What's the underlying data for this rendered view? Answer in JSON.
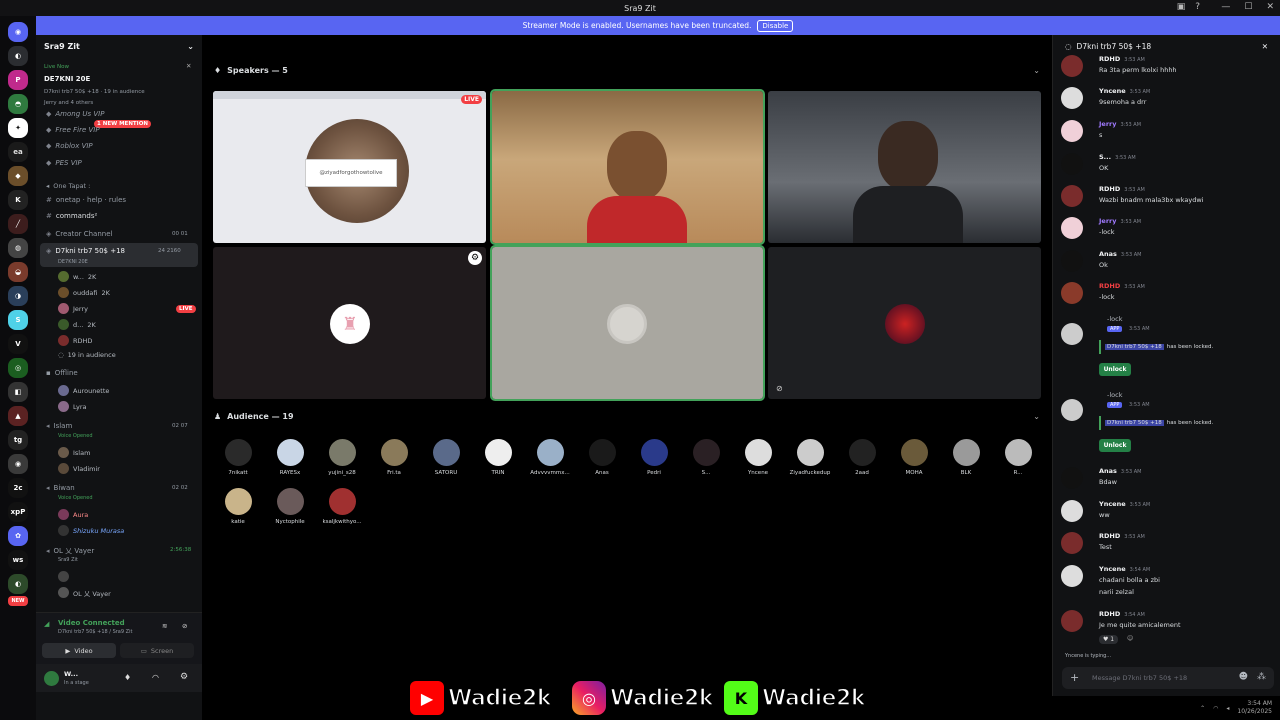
{
  "window": {
    "title": "Sra9 Zit"
  },
  "banner": {
    "text": "Streamer Mode is enabled. Usernames have been truncated.",
    "button": "Disable"
  },
  "rail": {
    "badges": [
      "82",
      "ea",
      "tg",
      "2c",
      "xpP",
      "ws",
      "NEW"
    ]
  },
  "sidebar": {
    "server_name": "Sra9 Zit",
    "live_label": "Live Now",
    "live_channel": "DE7KNI 20E",
    "live_sub": "D7kni trb7 50$ +18 · 19 in audience",
    "live_sub2": "Jerry and 4 others",
    "mention_badge": "1 NEW MENTION",
    "ch_among": "Among Us VIP",
    "ch_freefire": "Free Fire VIP",
    "ch_roblox": "Roblox VIP",
    "ch_pes": "PES VIP",
    "cat_onetapt": "One Tapat :",
    "ch_onetap": "onetap · help · rules",
    "ch_commands": "commands²",
    "ch_creator": "Creator Channel",
    "creator_count": "00 01",
    "active_channel": "D7kni trb7 50$ +18",
    "active_sub": "DE7KNI 20E",
    "active_count": "24 2160",
    "users": [
      {
        "name": "w...",
        "tag": "2K"
      },
      {
        "name": "ouddafi",
        "tag": "2K"
      },
      {
        "name": "Jerry",
        "tag": ""
      },
      {
        "name": "d...",
        "tag": "2K"
      },
      {
        "name": "RDHD",
        "tag": ""
      }
    ],
    "live_pill": "LIVE",
    "audience_count": "19 in audience",
    "offline_label": "Offline",
    "offline_users": [
      "Aurounette",
      "Lyra"
    ],
    "islam_channel": "Islam",
    "islam_sub": "Voice Opened",
    "islam_count": "02 07",
    "islam_users": [
      "Islam",
      "Vladimir"
    ],
    "biwan_channel": "Biwan",
    "biwan_sub": "Voice Opened",
    "biwan_count": "02 02",
    "biwan_users": [
      "Aura",
      "Shizuku Murasa"
    ],
    "vayer_channel": "OL 乂 Vayer",
    "vayer_sub": "Sra9 Zit",
    "vayer_time": "2:56:38",
    "vayer_user": "OL 乂 Vayer"
  },
  "voice": {
    "status": "Video Connected",
    "sub": "D7kni trb7 50$ +18 / Sra9 Zit",
    "video_btn": "Video",
    "screen_btn": "Screen"
  },
  "user": {
    "name": "W...",
    "status": "In a stage"
  },
  "stage": {
    "speakers_label": "Speakers — 5",
    "audience_label": "Audience — 19",
    "live_tag": "LIVE",
    "stream_text": "@ziyadforgothowtolive",
    "audience": [
      "7nikatt",
      "RAYESx",
      "yujini_s28",
      "Fri.ta",
      "SATORU",
      "TRIN",
      "Advvvvmmx...",
      "Anas",
      "Pedri",
      "S...",
      "Yncene",
      "Ziyadfuckedup",
      "2aad",
      "MOHA",
      "BLK",
      "R...",
      "katie",
      "Nyctophile",
      "ksaljkwithyo..."
    ]
  },
  "chat": {
    "title": "D7kni trb7 50$ +18",
    "messages": [
      {
        "name": "RDHD",
        "time": "3:53 AM",
        "text": "Ra 3ta perm lkolxi hhhh"
      },
      {
        "name": "Yncene",
        "time": "3:53 AM",
        "text": "9semoha a drr"
      },
      {
        "name": "Jerry",
        "time": "3:53 AM",
        "text": "s"
      },
      {
        "name": "S...",
        "time": "3:53 AM",
        "text": "OK"
      },
      {
        "name": "RDHD",
        "time": "3:53 AM",
        "text": "Wazbi bnadm mala3bx wkaydwi"
      },
      {
        "name": "Jerry",
        "time": "3:53 AM",
        "text": "-lock"
      },
      {
        "name": "Anas",
        "time": "3:53 AM",
        "text": "Ok"
      },
      {
        "name": "RDHD",
        "time": "3:53 AM",
        "text": "-lock"
      },
      {
        "name": "Anas",
        "time": "3:53 AM",
        "text": "Bdaw"
      },
      {
        "name": "Yncene",
        "time": "3:53 AM",
        "text": "ww"
      },
      {
        "name": "RDHD",
        "time": "3:53 AM",
        "text": "Test"
      },
      {
        "name": "Yncene",
        "time": "3:54 AM",
        "text": "chadani bolla a zbi"
      },
      {
        "name": "RDHD",
        "time": "3:54 AM",
        "text": "Je me quite amicalement"
      }
    ],
    "msg_line2": "narii zelzal",
    "bot_cmd": "-lock",
    "bot_tag": "APP",
    "bot_time": "3:53 AM",
    "locked_channel": "D7kni trb7 50$ +18",
    "locked_text": "has been locked.",
    "unlock_btn": "Unlock",
    "typing": "Yncene is typing...",
    "placeholder": "Message D7kni trb7 50$ +18"
  },
  "overlay": {
    "youtube": "Wadie2k",
    "instagram": "Wadie2k",
    "kick": "Wadie2k"
  },
  "taskbar": {
    "time": "3:54 AM",
    "date": "10/26/2025"
  },
  "colors": {
    "accent": "#5865f2",
    "green": "#43a25a",
    "live": "#f23f43",
    "bg": "#000000"
  }
}
